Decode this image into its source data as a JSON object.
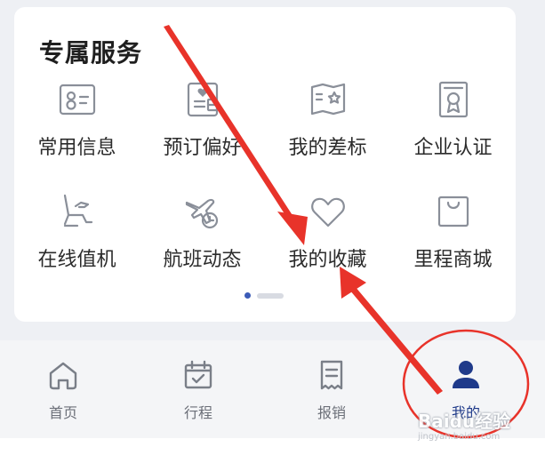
{
  "section": {
    "title": "专属服务"
  },
  "services": [
    {
      "label": "常用信息",
      "icon": "id-card-icon"
    },
    {
      "label": "预订偏好",
      "icon": "preference-card-icon"
    },
    {
      "label": "我的差标",
      "icon": "travel-standard-icon"
    },
    {
      "label": "企业认证",
      "icon": "certificate-icon"
    },
    {
      "label": "在线值机",
      "icon": "seat-checkin-icon"
    },
    {
      "label": "航班动态",
      "icon": "flight-status-icon"
    },
    {
      "label": "我的收藏",
      "icon": "heart-icon"
    },
    {
      "label": "里程商城",
      "icon": "shopping-bag-icon"
    }
  ],
  "pager": {
    "pages": 2,
    "current": 1
  },
  "tabbar": {
    "tabs": [
      {
        "label": "首页",
        "icon": "home-icon",
        "active": false
      },
      {
        "label": "行程",
        "icon": "calendar-icon",
        "active": false
      },
      {
        "label": "报销",
        "icon": "receipt-icon",
        "active": false
      },
      {
        "label": "我的",
        "icon": "user-icon",
        "active": true
      }
    ]
  },
  "watermark": {
    "text": "Baidu经验",
    "sub": "jingyan.baidu.com"
  },
  "colors": {
    "icon_stroke": "#8a8f99",
    "accent": "#1f3a8a",
    "annotation": "#e8332a"
  }
}
